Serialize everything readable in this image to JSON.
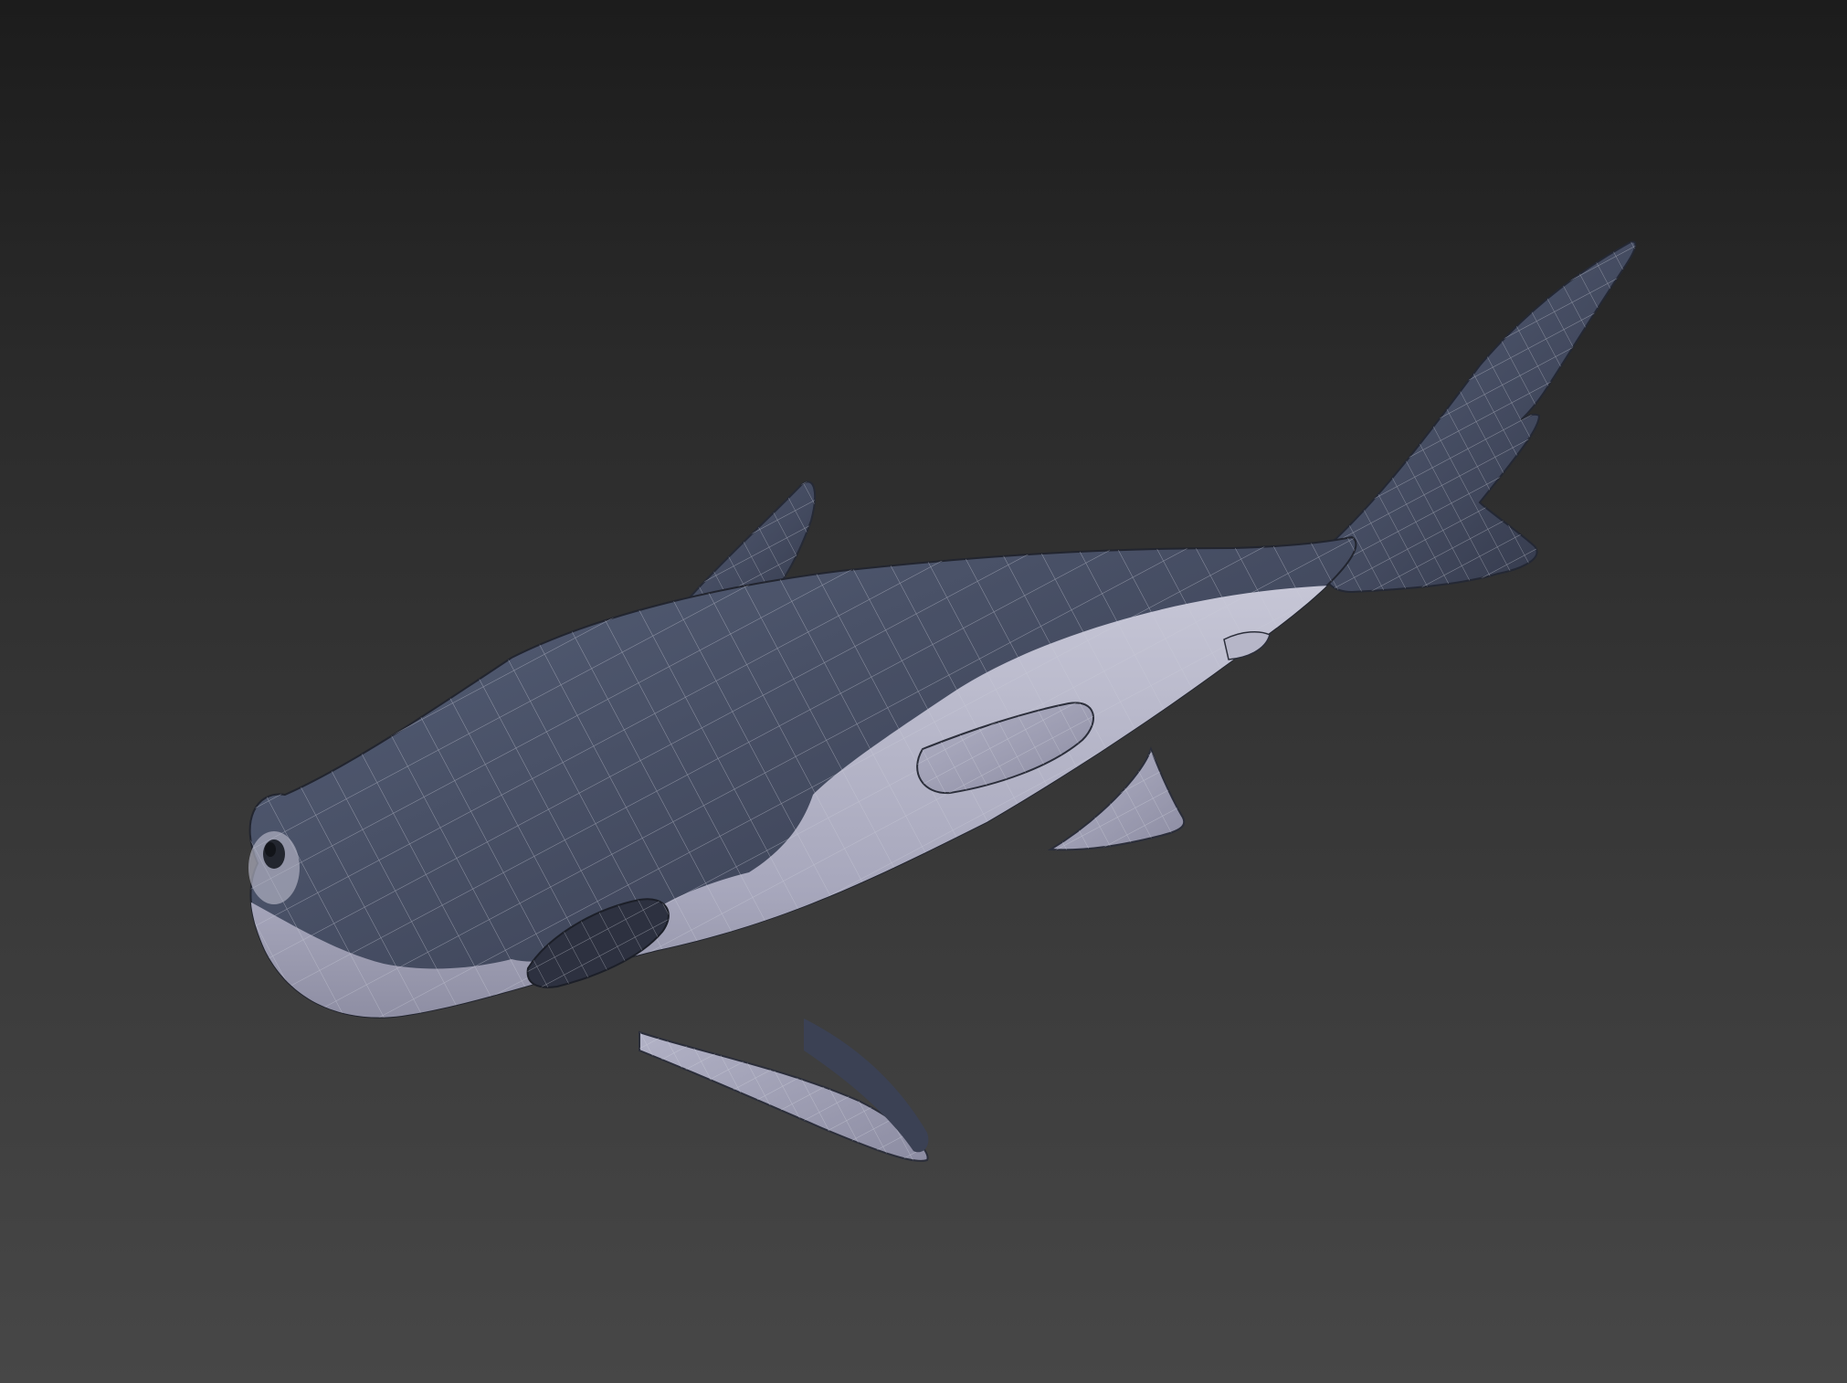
{
  "viewport": {
    "background_top": "#1c1c1c",
    "background_bottom": "#474747"
  },
  "model": {
    "subject": "shark-3d-model",
    "display_mode": "shaded-with-wireframe",
    "colors": {
      "dorsal_body": "#3f4557",
      "dorsal_body_light": "#545b70",
      "belly": "#a8a8bd",
      "belly_light": "#c4c4d4",
      "wire": "#c9ccd8"
    }
  }
}
